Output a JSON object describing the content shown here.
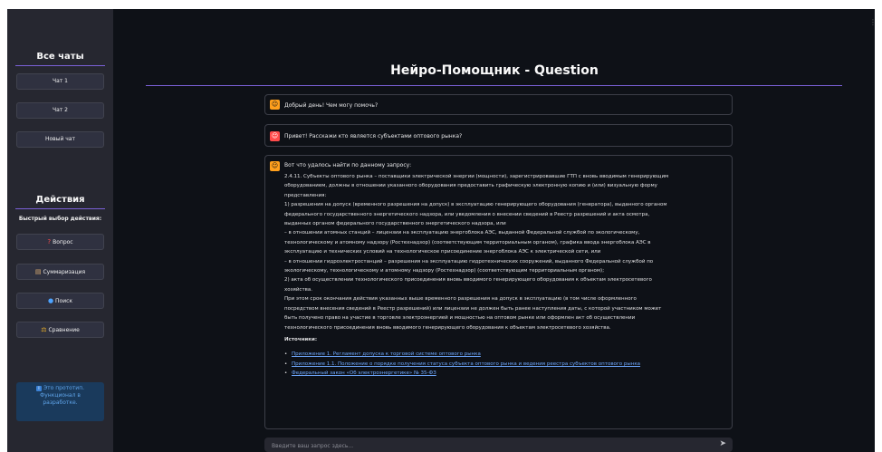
{
  "sidebar": {
    "chats_heading": "Все чаты",
    "chats": [
      "Чат 1",
      "Чат 2",
      "Новый чат"
    ],
    "actions_heading": "Действия",
    "quick_label": "Быстрый выбор действия:",
    "actions": [
      {
        "icon": "?",
        "icon_name": "question-icon",
        "label": "Вопрос"
      },
      {
        "icon": "▤",
        "icon_name": "document-icon",
        "label": "Суммаризация"
      },
      {
        "icon": "●",
        "icon_name": "search-icon",
        "label": "Поиск"
      },
      {
        "icon": "⚖",
        "icon_name": "scales-icon",
        "label": "Сравнение"
      }
    ],
    "info": {
      "icon": "i",
      "line1": "Это прототип.",
      "line2": "Функционал в",
      "line3": "разработке."
    }
  },
  "menu_icon": "⋮",
  "main": {
    "title": "Нейро-Помощник - Question",
    "messages": [
      {
        "role": "bot",
        "icon": "☺",
        "text": "Добрый день! Чем могу помочь?"
      },
      {
        "role": "user",
        "icon": "☺",
        "text": "Привет! Расскажи кто является субъектами оптового рынка?"
      }
    ],
    "answer": {
      "icon": "☺",
      "intro": "Вот что удалось найти по данному запросу:",
      "lines": [
        "2.4.11. Субъекты оптового рынка – поставщики электрической энергии (мощности), зарегистрировавшие ГТП с вновь вводимым генерирующим",
        "оборудованием, должны в отношении указанного оборудования предоставить графическую электронную копию и (или) визуальную форму",
        "представления:",
        "1) разрешения на допуск (временного разрешения на допуск) в эксплуатацию генерирующего оборудования (генератора), выданного органом",
        "федерального государственного энергетического надзора, или уведомления о внесении сведений в Реестр разрешений и акта осмотра,",
        "выданных органом федерального государственного энергетического надзора, или",
        "– в отношении атомных станций – лицензии на эксплуатацию энергоблока АЭС, выданной Федеральной службой по экологическому,",
        "технологическому и атомному надзору (Ростехнадзор) (соответствующим территориальным органом), графика ввода энергоблока АЭС в",
        "эксплуатацию и технических условий на технологическое присоединение энергоблока АЭС к электрической сети, или",
        "– в отношении гидроэлектростанций – разрешения на эксплуатацию гидротехнических сооружений, выданного Федеральной службой по",
        "экологическому, технологическому и атомному надзору (Ростехнадзор) (соответствующим территориальным органом);",
        "2) акта об осуществлении технологического присоединения вновь вводимого генерирующего оборудования к объектам электросетевого",
        "хозяйства.",
        "При этом срок окончания действия указанных выше временного разрешения на допуск в эксплуатацию (в том числе оформленного",
        "посредством внесения сведений в Реестр разрешений) или лицензии не должен быть ранее наступления даты, с которой участником может",
        "быть получено право на участие в торговле электроэнергией и мощностью на оптовом рынке или оформлен акт об осуществлении",
        "технологического присоединения вновь вводимого генерирующего оборудования к объектам электросетевого хозяйства."
      ],
      "sources_label": "Источники:",
      "sources": [
        "Приложение 1. Регламент допуска к торговой системе оптового рынка",
        "Приложение 1.1. Положение о порядке получения статуса субъекта оптового рынка и ведения реестра субъектов оптового рынка",
        "Федеральный закон «Об электроэнергетике» № 35-ФЗ"
      ]
    },
    "input": {
      "placeholder": "Введите ваш запрос здесь...",
      "value": "",
      "send_icon": "➤"
    }
  }
}
